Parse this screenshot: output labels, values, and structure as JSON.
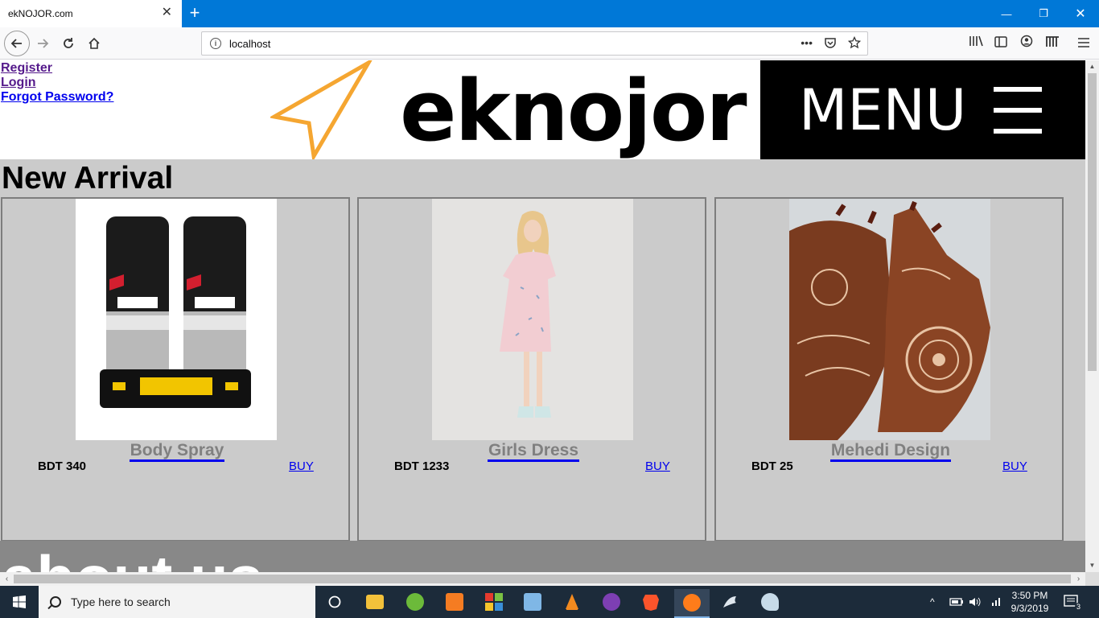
{
  "browser": {
    "tab_title": "ekNOJOR.com",
    "tab_close": "✕",
    "new_tab": "+",
    "url": "localhost",
    "url_more": "•••"
  },
  "header": {
    "links": [
      "Register",
      "Login",
      "Forgot Password?"
    ],
    "logo_text": "eknojor",
    "menu_label": "MENU"
  },
  "main": {
    "section_title": "New Arrival",
    "products": [
      {
        "name": "Body Spray",
        "price": "BDT 340",
        "buy": "BUY"
      },
      {
        "name": "Girls Dress",
        "price": "BDT 1233",
        "buy": "BUY"
      },
      {
        "name": "Mehedi Design",
        "price": "BDT 25",
        "buy": "BUY"
      }
    ]
  },
  "about": {
    "title": "about us"
  },
  "taskbar": {
    "search_placeholder": "Type here to search",
    "time": "3:50 PM",
    "date": "9/3/2019",
    "notifications": "3"
  },
  "colors": {
    "browser_accent": "#0078d7",
    "logo_arrow": "#f5a631",
    "main_bg": "#cbcbcb",
    "about_bg": "#888888",
    "link_blue": "#0000ee",
    "link_visited": "#551a8b"
  }
}
